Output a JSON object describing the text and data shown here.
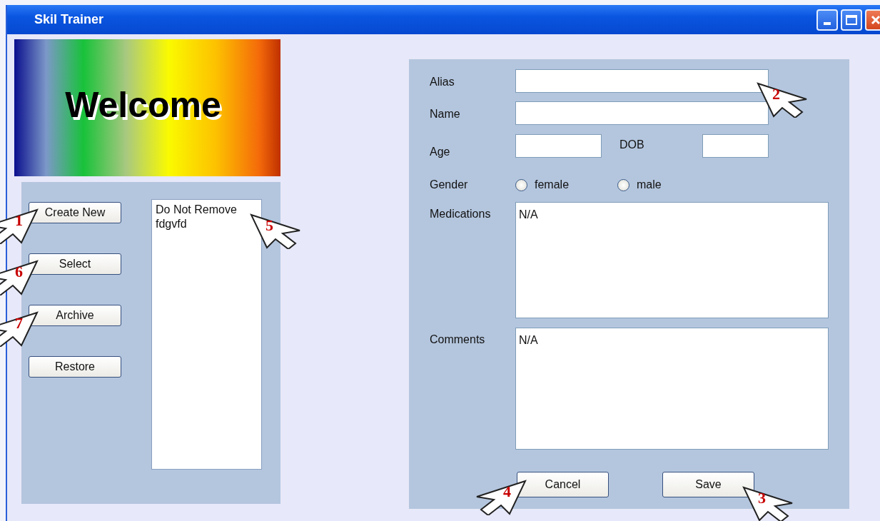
{
  "window": {
    "title": "Skil Trainer"
  },
  "banner": {
    "text": "Welcome"
  },
  "actions": [
    {
      "label": "Create New",
      "callout": {
        "number": "1",
        "kind": "rightward"
      }
    },
    {
      "label": "Select",
      "callout": {
        "number": "6",
        "kind": "rightward"
      }
    },
    {
      "label": "Archive",
      "callout": {
        "number": "7",
        "kind": "rightward"
      }
    },
    {
      "label": "Restore"
    }
  ],
  "list": {
    "items": [
      {
        "text": "Do Not Remove",
        "selected": false,
        "callout": {
          "number": "5",
          "kind": "leftward"
        }
      },
      {
        "text": "fdgvfd",
        "selected": false
      }
    ]
  },
  "form": {
    "alias": {
      "label": "Alias",
      "callout": {
        "number": "2",
        "kind": "leftward"
      }
    },
    "name": {
      "label": "Name"
    },
    "age": {
      "label": "Age"
    },
    "dob": {
      "label": "DOB"
    },
    "gender": {
      "label": "Gender",
      "options": [
        {
          "label": "female",
          "selected": false
        },
        {
          "label": "male",
          "selected": false
        }
      ]
    },
    "medications": {
      "label": "Medications",
      "value": "N/A"
    },
    "comments": {
      "label": "Comments",
      "value": "N/A"
    },
    "buttons": [
      {
        "label": "Cancel",
        "callout": {
          "number": "4",
          "kind": "rightward"
        }
      },
      {
        "label": "Save",
        "callout": {
          "number": "3",
          "kind": "leftward"
        }
      }
    ]
  }
}
